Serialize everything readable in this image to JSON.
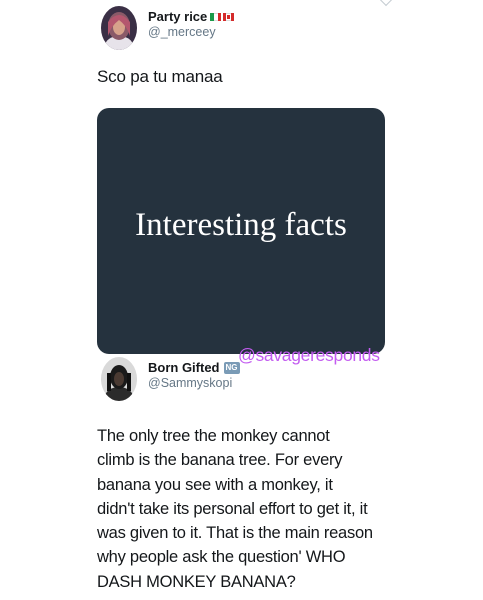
{
  "tweet_1": {
    "display_name": "Party rice",
    "handle": "@_merceey",
    "text": "Sco pa tu manaa",
    "flag_icons": [
      "italy-flag-icon",
      "canada-flag-icon"
    ],
    "media": {
      "title": "Interesting facts",
      "background_color": "#25323e"
    }
  },
  "watermark": "@savageresponds",
  "tweet_2": {
    "display_name": "Born Gifted",
    "badge": "NG",
    "handle": "@Sammyskopi",
    "text_lines": [
      "The only tree the monkey cannot",
      "climb is the banana tree. For every",
      "banana you see with a monkey, it",
      "didn't take its personal effort to get it, it",
      "was given to it. That is the main reason",
      "why people ask the question' WHO",
      "DASH MONKEY BANANA?"
    ]
  },
  "colors": {
    "handle_gray": "#657786",
    "watermark_purple": "#c35cf0",
    "text_dark": "#14171a"
  }
}
